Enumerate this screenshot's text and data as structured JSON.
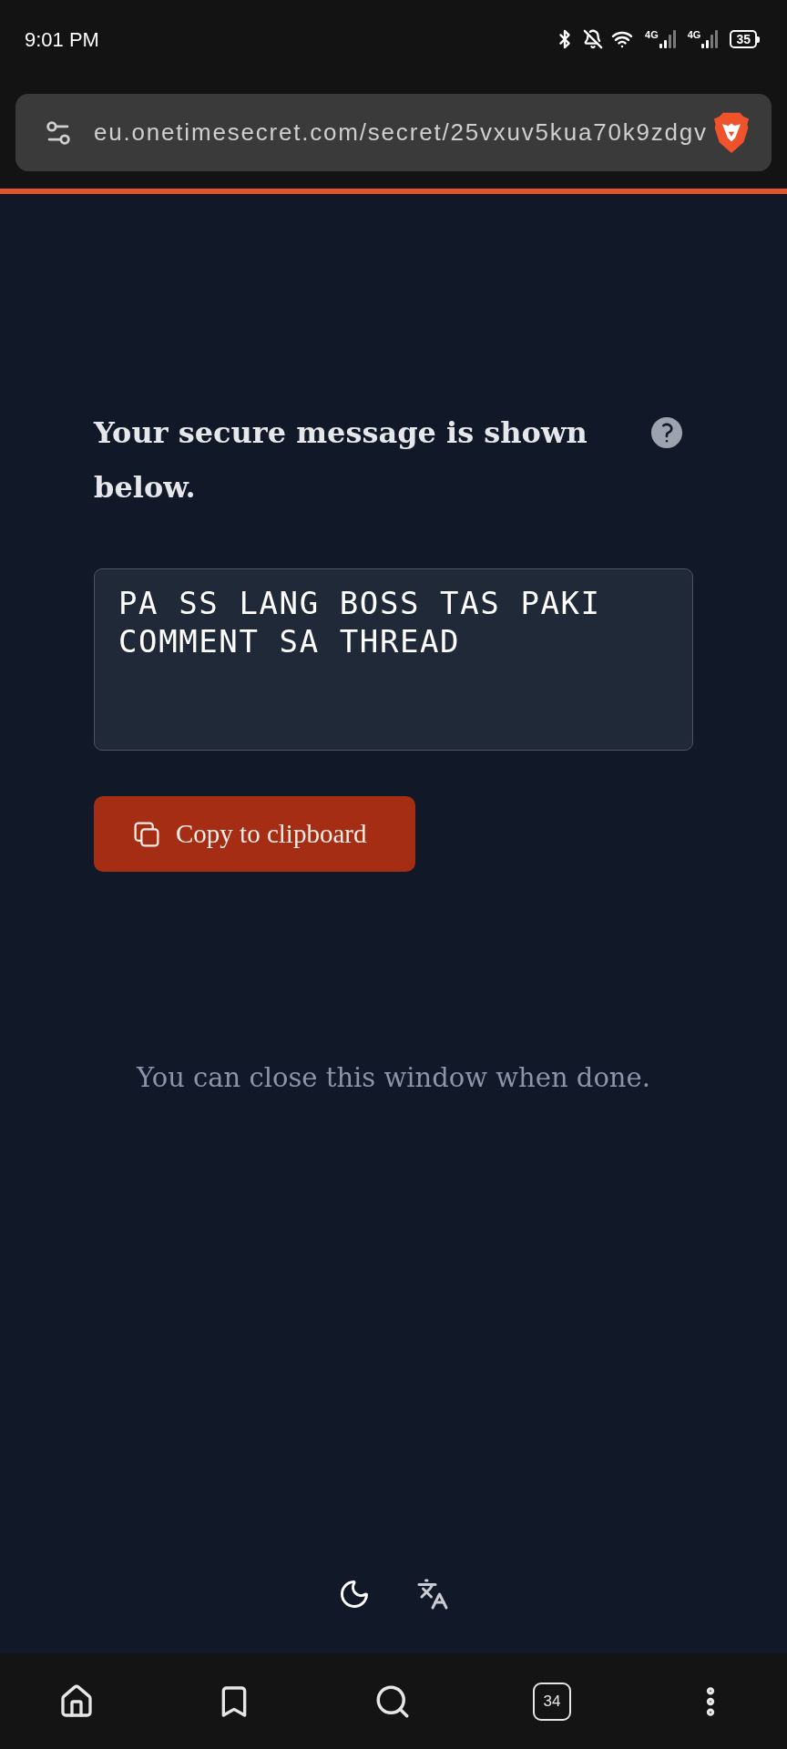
{
  "status_bar": {
    "time": "9:01 PM",
    "networks": [
      {
        "label": "4G"
      },
      {
        "label": "4G"
      }
    ],
    "battery": "35"
  },
  "address_bar": {
    "url": "eu.onetimesecret.com/secret/25vxuv5kua70k9zdgv"
  },
  "page": {
    "heading": "Your secure message is shown below.",
    "secret": "PA SS LANG BOSS TAS PAKI COMMENT SA THREAD",
    "copy_button": "Copy to clipboard",
    "note": "You can close this window when done."
  },
  "toolbar": {
    "tab_count": "34"
  }
}
